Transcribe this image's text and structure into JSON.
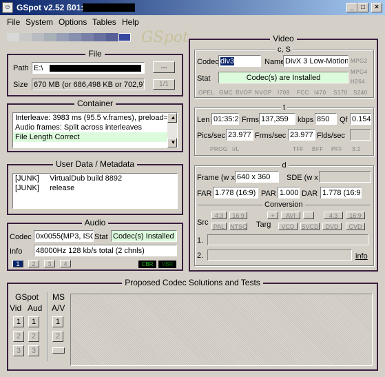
{
  "window": {
    "title": "GSpot v2.52 ß01:",
    "icon": "gspot-face-icon"
  },
  "controls": {
    "minimize": "_",
    "maximize": "□",
    "close": "×"
  },
  "menu": [
    "File",
    "System",
    "Options",
    "Tables",
    "Help"
  ],
  "logo": "GSpot",
  "file": {
    "legend": "File",
    "path_label": "Path",
    "path_value": "E:\\",
    "browse": "...",
    "size_label": "Size",
    "size_value": "670 MB (or 686,498 KB or 702,97",
    "page": "1/1"
  },
  "container": {
    "legend": "Container",
    "lines": [
      "Interleave: 3983 ms (95.5 v.frames), preload=3",
      "Audio frames: Split across interleaves",
      "File Length Correct"
    ]
  },
  "userdata": {
    "legend": "User Data / Metadata",
    "lines": [
      "[JUNK]     VirtualDub build 8892",
      "[JUNK]     release"
    ]
  },
  "audio": {
    "legend": "Audio",
    "codec_label": "Codec",
    "codec_value": "0x0055(MP3, ISO",
    "stat_label": "Stat",
    "stat_value": "Codec(s) Installed",
    "info_label": "Info",
    "info_value": "48000Hz  128 kb/s total (2 chnls)",
    "tabs": [
      "1",
      "2",
      "3",
      "4"
    ],
    "cbr": "CBR",
    "vbr": "VBR"
  },
  "video": {
    "legend": "Video",
    "cs": {
      "legend": "c, S",
      "codec_label": "Codec",
      "codec_value": "div3",
      "name_label": "Name",
      "name_value": "DivX 3 Low-Motion",
      "stat_label": "Stat",
      "stat_value": "Codec(s) are Installed",
      "side_flags": [
        "MPG2",
        "MPG4",
        "H264"
      ],
      "flags": [
        "OPEL",
        "GMC",
        "BVOP",
        "NVOP",
        "I709",
        "FCC",
        "I470",
        "S170",
        "S240"
      ]
    },
    "t": {
      "legend": "t",
      "len_label": "Len",
      "len_value": "01:35:2",
      "frms_label": "Frms",
      "frms_value": "137,359",
      "kbps_label": "kbps",
      "kbps_value": "850",
      "qf_label": "Qf",
      "qf_value": "0.154",
      "pics_label": "Pics/sec",
      "pics_value": "23.977",
      "fms_label": "Frms/sec",
      "fms_value": "23.977",
      "flds_label": "Flds/sec",
      "flds_value": "",
      "flags": [
        "PROG",
        "I/L",
        "TFF",
        "BFF",
        "PFF",
        "3:2"
      ]
    },
    "d": {
      "legend": "d",
      "frame_label": "Frame (w x",
      "frame_value": "640 x 360",
      "sde_label": "SDE (w x",
      "far_label": "FAR",
      "far_value": "1.778 (16:9)",
      "par_label": "PAR",
      "par_value": "1.000",
      "dar_label": "DAR",
      "dar_value": "1.778 (16:9)",
      "conversion": "Conversion",
      "src_label": "Src",
      "targ_label": "Targ",
      "src_flags": [
        "4:3",
        "16:9",
        "PAL",
        "NTSC"
      ],
      "targ_top": [
        "+",
        "AVI",
        "-",
        "4:3",
        "16:9"
      ],
      "targ_bottom": [
        "VCD",
        "SVCD",
        "DVD",
        "CVD"
      ],
      "row1": "1.",
      "row2": "2.",
      "info": "info"
    }
  },
  "proposed": {
    "legend": "Proposed Codec Solutions and Tests",
    "gspot": "GSpot",
    "vid": "Vid",
    "aud": "Aud",
    "ms": "MS",
    "av": "A/V",
    "nums": [
      "1",
      "2",
      "3"
    ]
  },
  "colors": {
    "group_border": "#3a1d3f",
    "green_field": "#dcfadc",
    "titlebar": "#0a246a"
  }
}
